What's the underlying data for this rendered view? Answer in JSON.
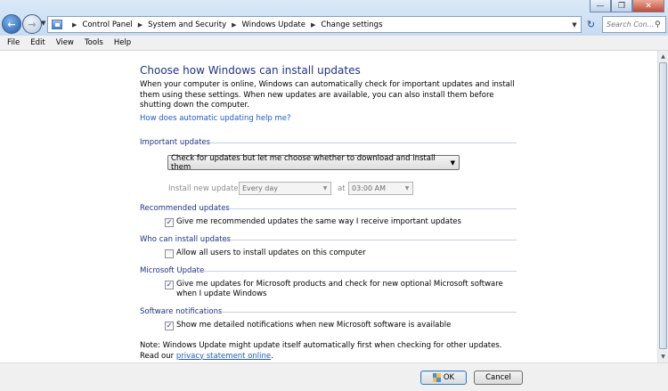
{
  "breadcrumb": [
    "Control Panel",
    "System and Security",
    "Windows Update",
    "Change settings"
  ],
  "search": {
    "placeholder": "Search Con..."
  },
  "menu": [
    "File",
    "Edit",
    "View",
    "Tools",
    "Help"
  ],
  "main": {
    "heading": "Choose how Windows can install updates",
    "intro": "When your computer is online, Windows can automatically check for important updates and install them using these settings. When new updates are available, you can also install them before shutting down the computer.",
    "help_link": "How does automatic updating help me?"
  },
  "important_updates": {
    "title": "Important updates",
    "selected_option": "Check for updates but let me choose whether to download and install them",
    "install_label": "Install new updates:",
    "frequency": "Every day",
    "at_label": "at",
    "time": "03:00 AM"
  },
  "recommended_updates": {
    "title": "Recommended updates",
    "checkbox_label": "Give me recommended updates the same way I receive important updates",
    "checked": true
  },
  "who_can_install": {
    "title": "Who can install updates",
    "checkbox_label": "Allow all users to install updates on this computer",
    "checked": false
  },
  "microsoft_update": {
    "title": "Microsoft Update",
    "checkbox_label": "Give me updates for Microsoft products and check for new optional Microsoft software when I update Windows",
    "checked": true
  },
  "software_notifications": {
    "title": "Software notifications",
    "checkbox_label": "Show me detailed notifications when new Microsoft software is available",
    "checked": true
  },
  "note": {
    "text": "Note: Windows Update might update itself automatically first when checking for other updates.  Read our ",
    "link": "privacy statement online",
    "suffix": "."
  },
  "buttons": {
    "ok": "OK",
    "cancel": "Cancel"
  },
  "colors": {
    "heading": "#1e3287",
    "link": "#1e5bc6",
    "chrome": "#f0f0f0"
  }
}
